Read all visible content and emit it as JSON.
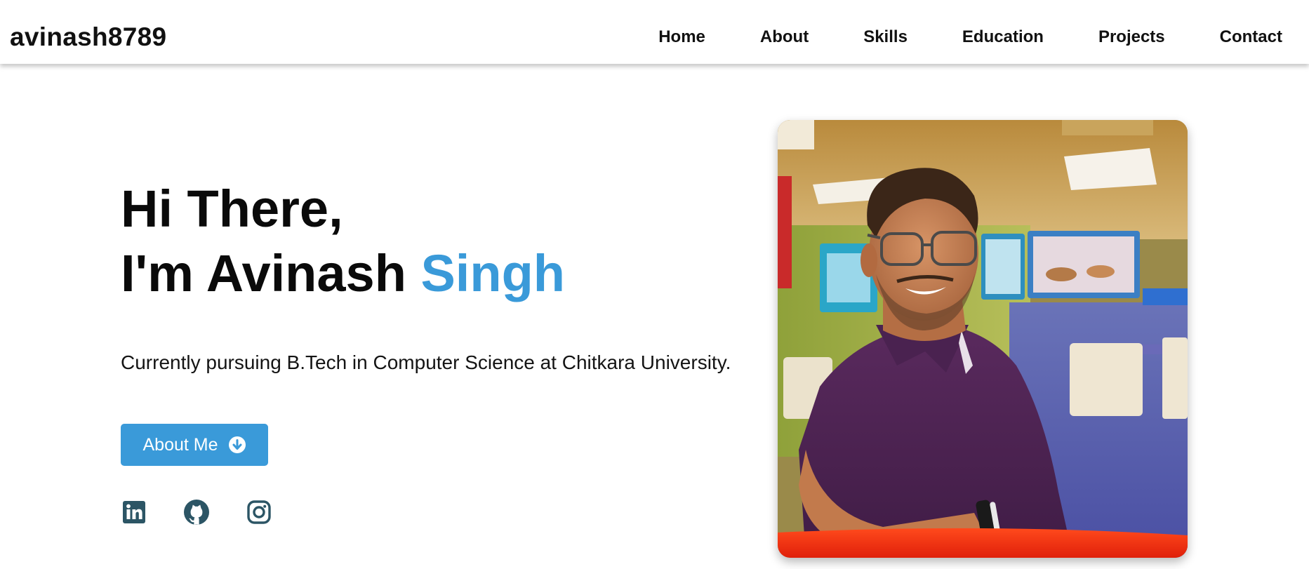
{
  "header": {
    "brand": "avinash8789",
    "nav": [
      {
        "label": "Home"
      },
      {
        "label": "About"
      },
      {
        "label": "Skills"
      },
      {
        "label": "Education"
      },
      {
        "label": "Projects"
      },
      {
        "label": "Contact"
      }
    ]
  },
  "hero": {
    "greeting": "Hi There,",
    "intro_prefix": "I'm Avinash ",
    "intro_highlight": "Singh",
    "subtitle": "Currently pursuing B.Tech in Computer Science at Chitkara University.",
    "button": {
      "label": "About Me",
      "icon": "arrow-circle-down-icon"
    },
    "socials": [
      {
        "icon": "linkedin-icon"
      },
      {
        "icon": "github-icon"
      },
      {
        "icon": "instagram-icon"
      }
    ],
    "photo": {
      "alt": "portrait photo"
    }
  },
  "colors": {
    "accent": "#3a9ad9",
    "icon": "#2c5565",
    "text": "#0a0a0a"
  }
}
